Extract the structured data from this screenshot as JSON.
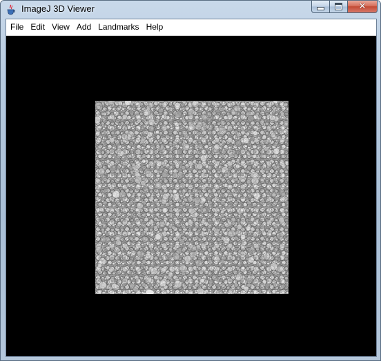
{
  "window": {
    "title": "ImageJ 3D Viewer",
    "app_icon": "java-cup-icon",
    "controls": [
      "minimize-icon",
      "maximize-icon",
      "close-icon"
    ]
  },
  "menubar": {
    "items": [
      {
        "label": "File"
      },
      {
        "label": "Edit"
      },
      {
        "label": "View"
      },
      {
        "label": "Add"
      },
      {
        "label": "Landmarks"
      },
      {
        "label": "Help"
      }
    ]
  },
  "viewport": {
    "background": "#000000",
    "content": "grayscale granular 3D volume rendering"
  },
  "colors": {
    "title_gradient_top": "#c9d9ea",
    "close_button": "#c24a34",
    "viewport_bg": "#000000"
  }
}
